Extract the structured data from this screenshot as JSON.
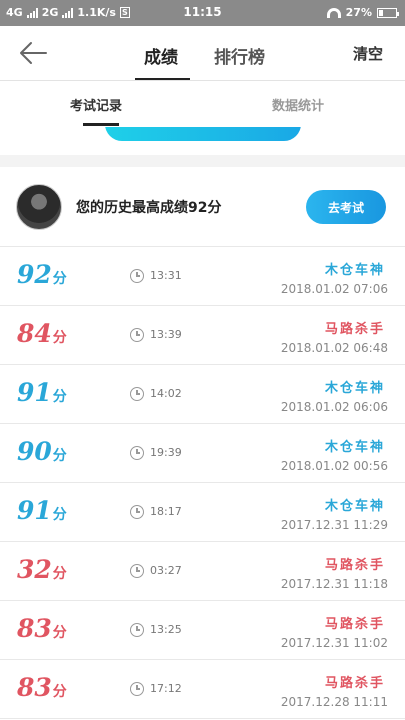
{
  "status_bar": {
    "network_left": "4G",
    "network_right": "2G",
    "speed": "1.1K/s",
    "time": "11:15",
    "battery": "27%",
    "battery_level": 0.27
  },
  "header": {
    "tabs": [
      {
        "label": "成绩",
        "active": true
      },
      {
        "label": "排行榜",
        "active": false
      }
    ],
    "clear_label": "清空"
  },
  "subtabs": [
    {
      "label": "考试记录",
      "active": true
    },
    {
      "label": "数据统计",
      "active": false
    }
  ],
  "best": {
    "text": "您的历史最高成绩92分",
    "button": "去考试"
  },
  "colors": {
    "pass": "#2aa7d8",
    "fail": "#e05561"
  },
  "records": [
    {
      "score": "92",
      "unit": "分",
      "duration": "13:31",
      "title": "木仓车神",
      "date": "2018.01.02  07:06",
      "status": "pass"
    },
    {
      "score": "84",
      "unit": "分",
      "duration": "13:39",
      "title": "马路杀手",
      "date": "2018.01.02  06:48",
      "status": "fail"
    },
    {
      "score": "91",
      "unit": "分",
      "duration": "14:02",
      "title": "木仓车神",
      "date": "2018.01.02  06:06",
      "status": "pass"
    },
    {
      "score": "90",
      "unit": "分",
      "duration": "19:39",
      "title": "木仓车神",
      "date": "2018.01.02  00:56",
      "status": "pass"
    },
    {
      "score": "91",
      "unit": "分",
      "duration": "18:17",
      "title": "木仓车神",
      "date": "2017.12.31  11:29",
      "status": "pass"
    },
    {
      "score": "32",
      "unit": "分",
      "duration": "03:27",
      "title": "马路杀手",
      "date": "2017.12.31  11:18",
      "status": "fail"
    },
    {
      "score": "83",
      "unit": "分",
      "duration": "13:25",
      "title": "马路杀手",
      "date": "2017.12.31  11:02",
      "status": "fail"
    },
    {
      "score": "83",
      "unit": "分",
      "duration": "17:12",
      "title": "马路杀手",
      "date": "2017.12.28  11:11",
      "status": "fail"
    }
  ]
}
